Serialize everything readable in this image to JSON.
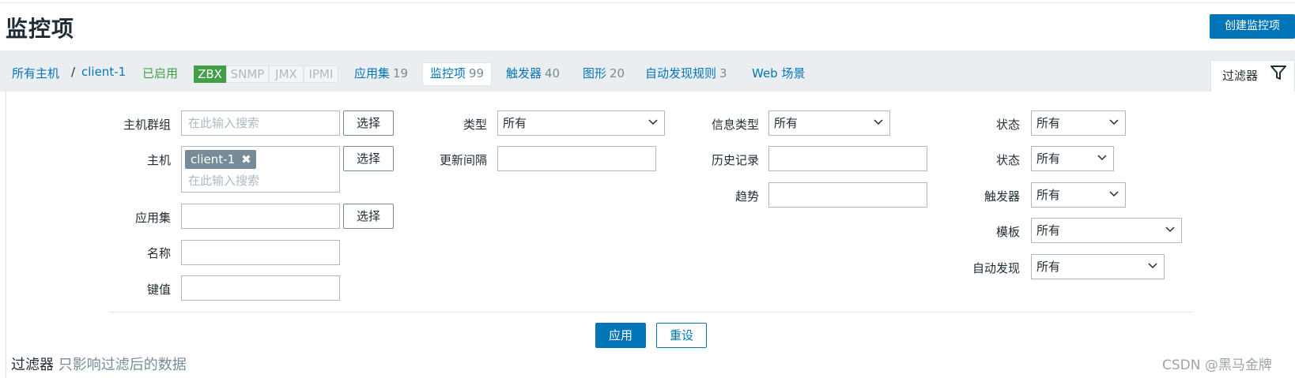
{
  "page": {
    "title": "监控项",
    "create_button": "创建监控项"
  },
  "nav": {
    "all_hosts": "所有主机",
    "separator": "/",
    "host": "client-1",
    "status": "已启用",
    "protocols": [
      {
        "label": "ZBX",
        "active": true
      },
      {
        "label": "SNMP",
        "active": false
      },
      {
        "label": "JMX",
        "active": false
      },
      {
        "label": "IPMI",
        "active": false
      }
    ],
    "tabs": [
      {
        "label": "应用集",
        "count": "19"
      },
      {
        "label": "监控项",
        "count": "99"
      },
      {
        "label": "触发器",
        "count": "40"
      },
      {
        "label": "图形",
        "count": "20"
      },
      {
        "label": "自动发现规则",
        "count": "3"
      },
      {
        "label": "Web 场景",
        "count": ""
      }
    ],
    "filter_tab": "过滤器"
  },
  "filter": {
    "host_group": {
      "label": "主机群组",
      "placeholder": "在此输入搜索",
      "button": "选择"
    },
    "host": {
      "label": "主机",
      "chip": "client-1",
      "chip_remove": "✖",
      "placeholder": "在此输入搜索",
      "button": "选择"
    },
    "application": {
      "label": "应用集",
      "value": "",
      "button": "选择"
    },
    "name": {
      "label": "名称",
      "value": ""
    },
    "key": {
      "label": "键值",
      "value": ""
    },
    "type": {
      "label": "类型",
      "value": "所有"
    },
    "update_interval": {
      "label": "更新间隔",
      "value": ""
    },
    "info_type": {
      "label": "信息类型",
      "value": "所有"
    },
    "history": {
      "label": "历史记录",
      "value": ""
    },
    "trends": {
      "label": "趋势",
      "value": ""
    },
    "state": {
      "label": "状态",
      "value": "所有"
    },
    "status": {
      "label": "状态",
      "value": "所有"
    },
    "triggers": {
      "label": "触发器",
      "value": "所有"
    },
    "template": {
      "label": "模板",
      "value": "所有"
    },
    "discovery": {
      "label": "自动发现",
      "value": "所有"
    },
    "apply_button": "应用",
    "reset_button": "重设"
  },
  "footer": {
    "note_main": "过滤器",
    "note_sub": "只影响过滤后的数据"
  },
  "watermark": "CSDN @黑马金牌",
  "colors": {
    "accent": "#0275b8",
    "enabled": "#429e47",
    "nav_bg": "#ebeef0",
    "muted": "#768d99"
  }
}
